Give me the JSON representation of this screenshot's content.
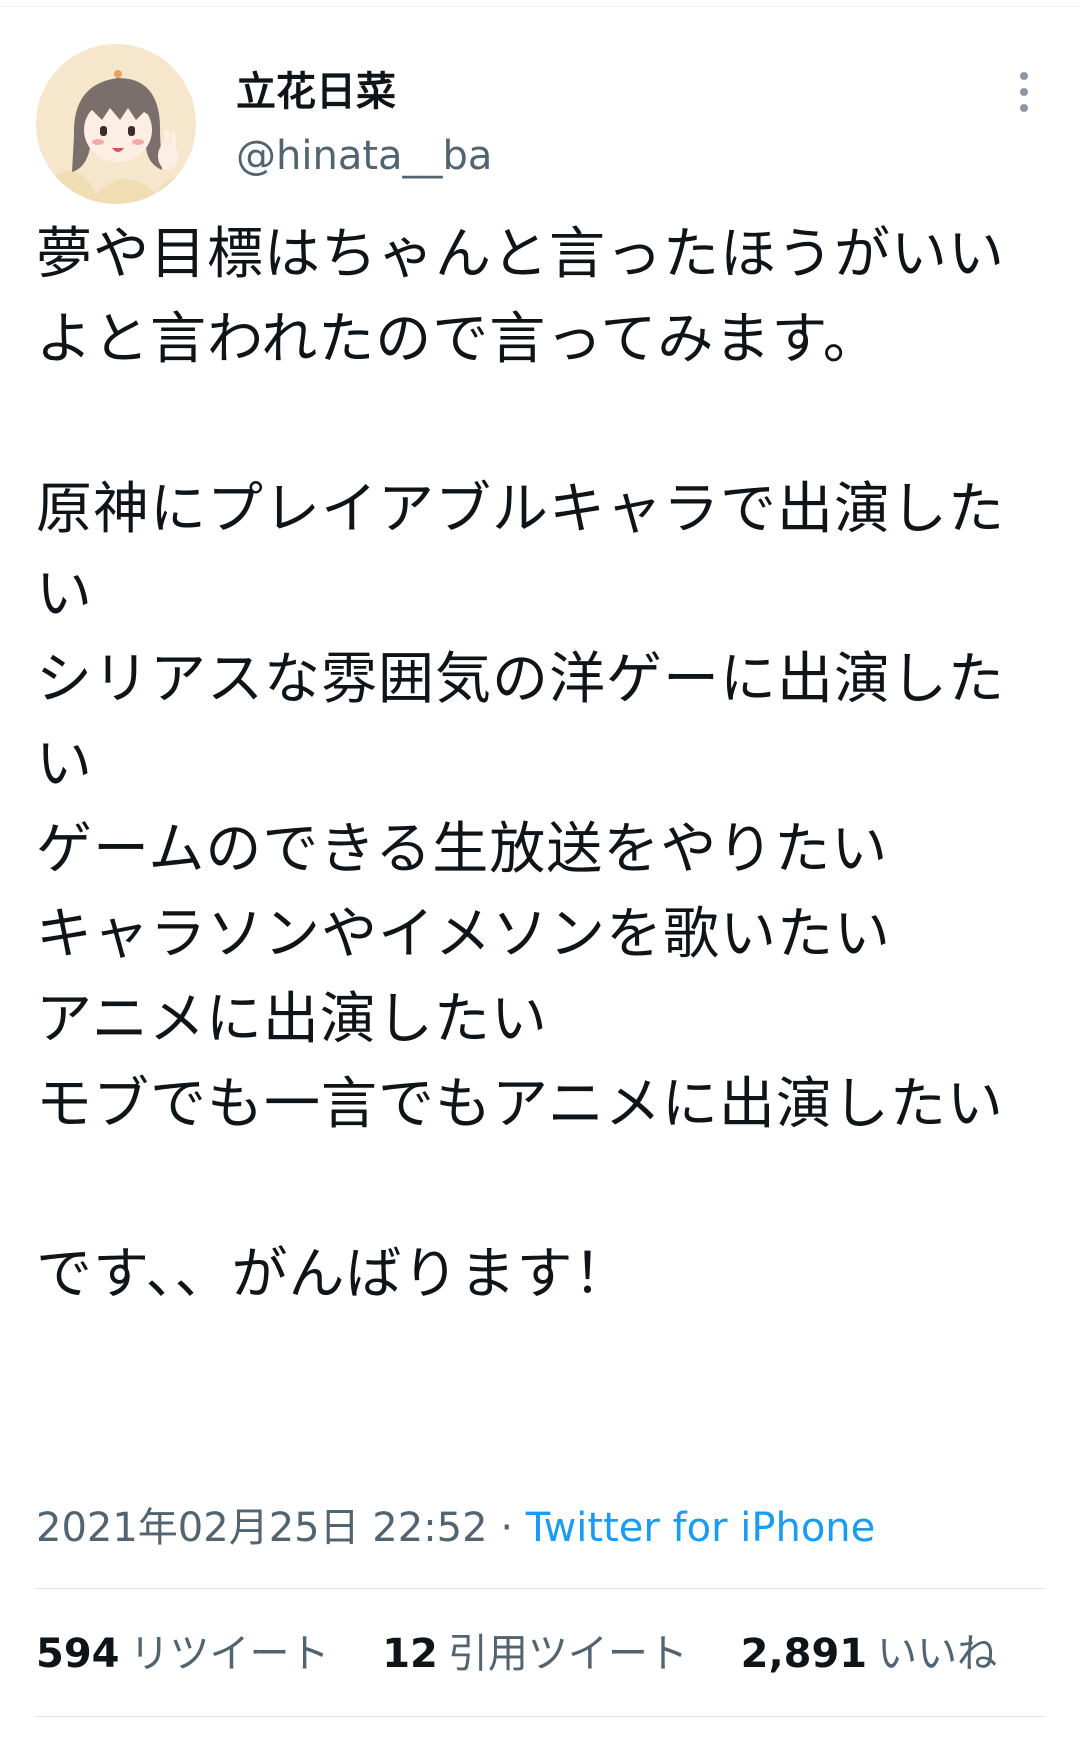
{
  "tweet": {
    "author": {
      "display_name": "立花日菜",
      "handle": "@hinata__ba"
    },
    "body_lines": [
      "夢や目標はちゃんと言ったほうがいいよと言われたので言ってみます。",
      "",
      "原神にプレイアブルキャラで出演したい",
      "シリアスな雰囲気の洋ゲーに出演したい",
      "ゲームのできる生放送をやりたい",
      "キャラソンやイメソンを歌いたい",
      "アニメに出演したい",
      "モブでも一言でもアニメに出演したい",
      "",
      "です、、がんばります！"
    ],
    "timestamp": "2021年02月25日 22:52",
    "separator": "·",
    "source": "Twitter for iPhone",
    "stats": {
      "retweets": {
        "count": "594",
        "label": "リツイート"
      },
      "quotes": {
        "count": "12",
        "label": "引用ツイート"
      },
      "likes": {
        "count": "2,891",
        "label": "いいね"
      }
    }
  },
  "icons": {
    "more": "more-vertical-icon",
    "avatar": "avatar-illustration"
  },
  "colors": {
    "text": "#0f1419",
    "secondary": "#536471",
    "link": "#1d9bf0",
    "divider": "#dfe4e8"
  }
}
